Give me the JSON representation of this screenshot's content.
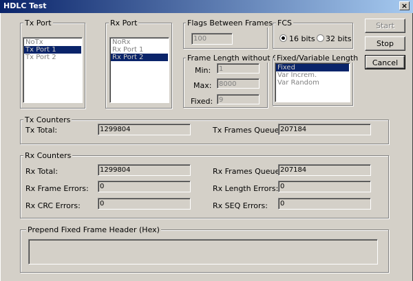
{
  "window": {
    "title": "HDLC Test",
    "close_glyph": "×"
  },
  "tx_port": {
    "title": "Tx Port",
    "items": [
      "NoTx",
      "Tx Port 1",
      "Tx Port 2"
    ],
    "selected": 1
  },
  "rx_port": {
    "title": "Rx Port",
    "items": [
      "NoRx",
      "Rx Port 1",
      "Rx Port 2"
    ],
    "selected": 2
  },
  "flags": {
    "title": "Flags Between Frames",
    "value": "100"
  },
  "fcs": {
    "title": "FCS",
    "option_16": "16 bits",
    "option_32": "32 bits",
    "selected": "16 bits"
  },
  "frame_length": {
    "title": "Frame Length without CRC",
    "min_label": "Min:",
    "min_value": "1",
    "max_label": "Max:",
    "max_value": "8000",
    "fixed_label": "Fixed:",
    "fixed_value": "9"
  },
  "fixed_variable": {
    "title": "Fixed/Variable Length",
    "items": [
      "Fixed",
      "Var Increm.",
      "Var Random"
    ],
    "selected": 0
  },
  "buttons": {
    "start": "Start",
    "stop": "Stop",
    "cancel": "Cancel"
  },
  "tx_counters": {
    "title": "Tx Counters",
    "total_label": "Tx Total:",
    "total_value": "1299804",
    "queued_label": "Tx Frames Queued:",
    "queued_value": "207184"
  },
  "rx_counters": {
    "title": "Rx Counters",
    "total_label": "Rx Total:",
    "total_value": "1299804",
    "queued_label": "Rx Frames Queued:",
    "queued_value": "207184",
    "frame_errors_label": "Rx Frame Errors:",
    "frame_errors_value": "0",
    "length_errors_label": "Rx Length Errors:",
    "length_errors_value": "0",
    "crc_errors_label": "Rx CRC Errors:",
    "crc_errors_value": "0",
    "seq_errors_label": "Rx SEQ Errors:",
    "seq_errors_value": "0"
  },
  "prepend": {
    "title": "Prepend Fixed Frame Header (Hex)",
    "value": ""
  }
}
